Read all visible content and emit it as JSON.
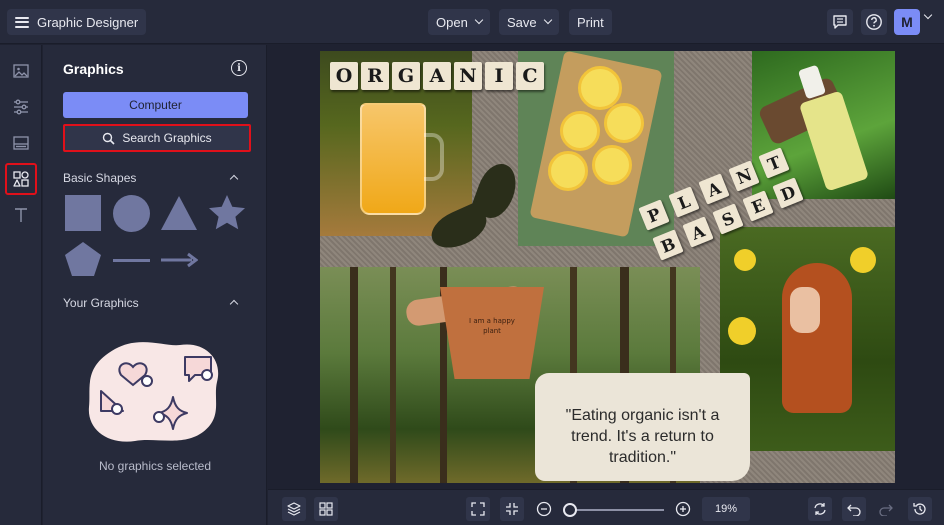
{
  "app": {
    "title": "Graphic Designer",
    "menu_icon": "hamburger-icon"
  },
  "toolbar": {
    "open_label": "Open",
    "save_label": "Save",
    "print_label": "Print",
    "icons": [
      "comment-icon",
      "help-icon"
    ],
    "avatar_initial": "M"
  },
  "rail": {
    "items": [
      "image-icon",
      "adjustments-icon",
      "layout-icon",
      "shapes-icon",
      "text-icon"
    ],
    "active": "shapes-icon"
  },
  "panel": {
    "title": "Graphics",
    "computer_label": "Computer",
    "search_label": "Search Graphics",
    "basic_shapes_heading": "Basic Shapes",
    "shapes": [
      "square",
      "circle",
      "triangle",
      "star",
      "pentagon",
      "line",
      "arrow"
    ],
    "your_graphics_heading": "Your Graphics",
    "empty_label": "No graphics selected"
  },
  "design": {
    "word_organic": [
      "O",
      "R",
      "G",
      "A",
      "N",
      "I",
      "C"
    ],
    "word_plant": [
      "P",
      "L",
      "A",
      "N",
      "T"
    ],
    "word_based": [
      "B",
      "A",
      "S",
      "E",
      "D"
    ],
    "pot_text_1": "I am a happy",
    "pot_text_2": "plant",
    "quote_line_1": "\"Eating organic isn't a",
    "quote_line_2": "trend. It's a return to",
    "quote_line_3": "tradition.\""
  },
  "bottom": {
    "zoom": "19%",
    "left_icons": [
      "layers-icon",
      "grid-icon"
    ],
    "fit_icons": [
      "fit-screen-icon",
      "shrink-icon"
    ],
    "right_icons": [
      "replace-icon",
      "undo-icon",
      "redo-icon",
      "history-icon"
    ]
  },
  "colors": {
    "accent": "#7b8cf6",
    "highlight": "#e0101a",
    "panel_bg": "#262a3b",
    "app_bg": "#1f2231"
  }
}
